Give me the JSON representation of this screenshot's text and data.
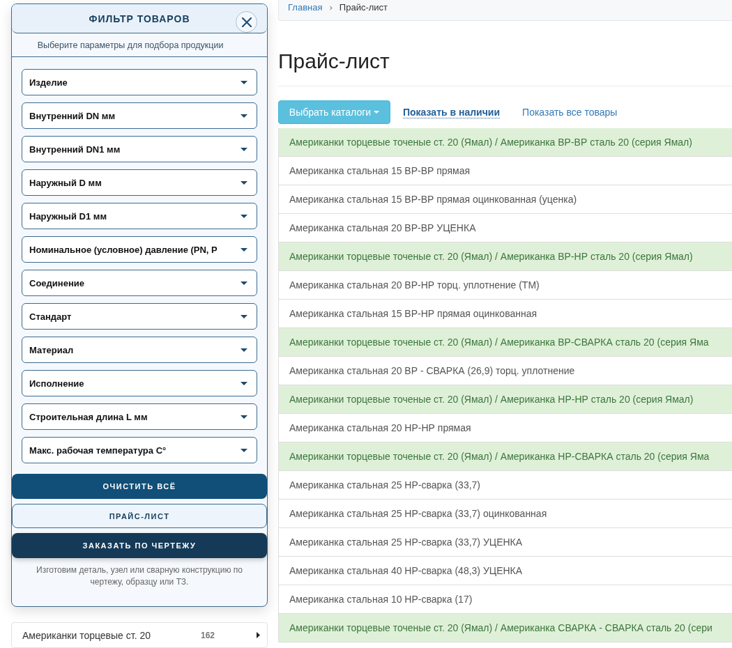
{
  "filter_panel": {
    "title": "ФИЛЬТР ТОВАРОВ",
    "subtitle": "Выберите параметры для подбора продукции",
    "filters": [
      {
        "label": "Изделие"
      },
      {
        "label": "Внутренний DN мм"
      },
      {
        "label": "Внутренний DN1 мм"
      },
      {
        "label": "Наружный D мм"
      },
      {
        "label": "Наружный D1 мм"
      },
      {
        "label": "Номинальное (условное) давление (PN, Р"
      },
      {
        "label": "Соединение"
      },
      {
        "label": "Стандарт"
      },
      {
        "label": "Материал"
      },
      {
        "label": "Исполнение"
      },
      {
        "label": "Строительная длина L мм"
      },
      {
        "label": "Макс. рабочая температура С°"
      }
    ],
    "buttons": [
      {
        "label": "ОЧИСТИТЬ ВСЁ",
        "kind": "primary"
      },
      {
        "label": "ПРАЙС-ЛИСТ",
        "kind": "outline"
      },
      {
        "label": "ЗАКАЗАТЬ ПО ЧЕРТЕЖУ",
        "kind": "dark"
      }
    ],
    "note": "Изготовим деталь, узел или сварную конструкцию по чертежу, образцу или ТЗ."
  },
  "category_list": [
    {
      "label": "Американки торцевые ст. 20",
      "count": "162"
    }
  ],
  "breadcrumb": {
    "separator": "›",
    "items": [
      {
        "label": "Главная",
        "kind": "link"
      },
      {
        "label": "Прайс-лист",
        "kind": "current"
      }
    ]
  },
  "page_title": "Прайс-лист",
  "toolbar": {
    "catalog_button": "Выбрать каталоги",
    "links": [
      {
        "label": "Показать в наличии",
        "selected": true
      },
      {
        "label": "Показать все товары",
        "selected": false
      }
    ]
  },
  "price_list": [
    {
      "text": "Американки торцевые точеные ст. 20 (Ямал) / Американка ВР-ВР сталь 20 (серия Ямал)",
      "kind": "group"
    },
    {
      "text": "Американка стальная 15 ВР-ВР прямая",
      "kind": "item"
    },
    {
      "text": "Американка стальная 15 ВР-ВР прямая оцинкованная (уценка)",
      "kind": "item"
    },
    {
      "text": "Американка стальная 20 ВР-ВР УЦЕНКА",
      "kind": "item"
    },
    {
      "text": "Американки торцевые точеные ст. 20 (Ямал) / Американка ВР-НР сталь 20 (серия Ямал)",
      "kind": "group"
    },
    {
      "text": "Американка стальная 20 ВР-НР торц. уплотнение (ТМ)",
      "kind": "item"
    },
    {
      "text": "Американка стальная 15 ВР-НР прямая оцинкованная",
      "kind": "item"
    },
    {
      "text": "Американки торцевые точеные ст. 20 (Ямал) / Американка ВР-СВАРКА сталь 20 (серия Яма",
      "kind": "group"
    },
    {
      "text": "Американка стальная 20 ВР - СВАРКА (26,9) торц. уплотнение",
      "kind": "item"
    },
    {
      "text": "Американки торцевые точеные ст. 20 (Ямал) / Американка НР-НР сталь 20 (серия Ямал)",
      "kind": "group"
    },
    {
      "text": "Американка стальная 20 НР-НР прямая",
      "kind": "item"
    },
    {
      "text": "Американки торцевые точеные ст. 20 (Ямал) / Американка НР-СВАРКА сталь 20 (серия Яма",
      "kind": "group"
    },
    {
      "text": "Американка стальная 25 НР-сварка (33,7)",
      "kind": "item"
    },
    {
      "text": "Американка стальная 25 НР-сварка (33,7) оцинкованная",
      "kind": "item"
    },
    {
      "text": "Американка стальная 25 НР-сварка (33,7) УЦЕНКА",
      "kind": "item"
    },
    {
      "text": "Американка стальная 40 НР-сварка (48,3) УЦЕНКА",
      "kind": "item"
    },
    {
      "text": "Американка стальная 10 НР-сварка (17)",
      "kind": "item"
    },
    {
      "text": "Американки торцевые точеные ст. 20 (Ямал) / Американка СВАРКА - СВАРКА сталь 20 (сери",
      "kind": "group"
    }
  ]
}
